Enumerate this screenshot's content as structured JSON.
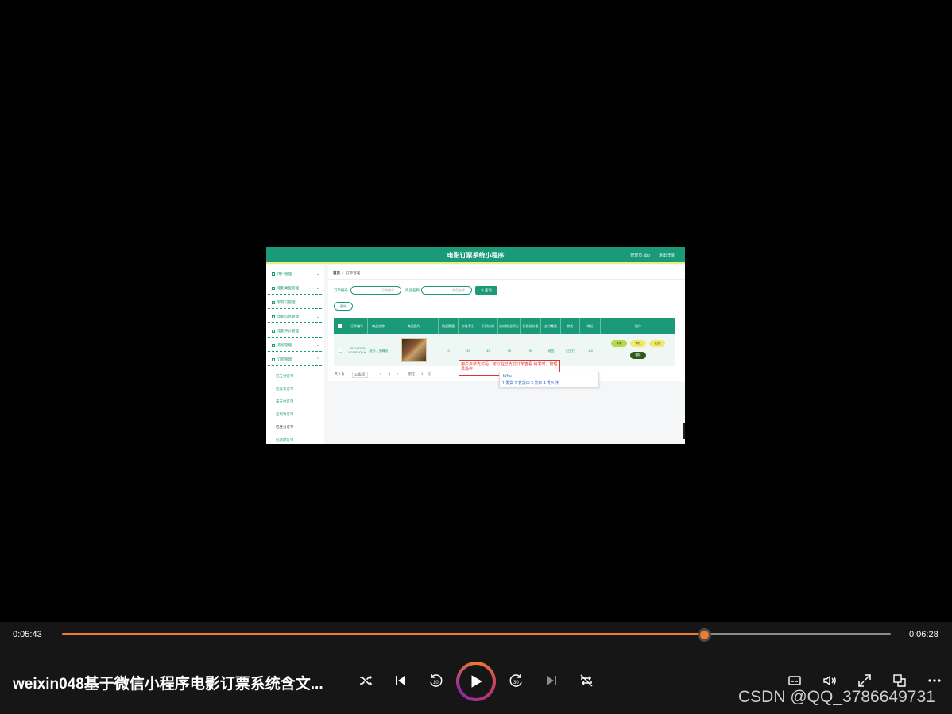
{
  "frame": {
    "app_title": "电影订票系统小程序",
    "user_info": "管理员 abo",
    "logout": "退出登录",
    "sidebar": {
      "items": [
        "用户管理",
        "电影类型管理",
        "影院订管理",
        "电影信息管理",
        "电影评价管理",
        "系统管理",
        "订单管理"
      ],
      "sub_items": [
        "已支付订单",
        "已发货订单",
        "未支付订单",
        "已取消订单",
        "已支付订单",
        "已退款订单"
      ]
    },
    "breadcrumb": {
      "home": "首页",
      "current": "订单管理"
    },
    "filters": {
      "order_no_label": "订单编号",
      "order_no_placeholder": "订单编号",
      "product_label": "商品名称",
      "product_placeholder": "商品名称",
      "search_button": "查询",
      "delete_button": "删除"
    },
    "table": {
      "headers": [
        "订单编号",
        "商品名称",
        "商品图片",
        "购买数量",
        "价格/积分",
        "折扣价格",
        "总价格/总积分",
        "折扣总价格",
        "支付类型",
        "状态",
        "地址",
        "操作"
      ],
      "row": {
        "order_no": "2021/02/09 1:07/02/09 fs",
        "product_name": "剧好、多峰员",
        "quantity": "2",
        "price": "45",
        "discount_price": "45",
        "total": "90",
        "discount_total": "90",
        "pay_type": "现金",
        "status": "已支付",
        "address": "1,4"
      },
      "ops": [
        "详情",
        "修改",
        "发货",
        "删除"
      ]
    },
    "pager": {
      "total": "共 1 条",
      "per_page": "10条/页",
      "page": "1",
      "goto": "前往",
      "goto_suffix": "页",
      "goto_page": "1"
    },
    "tooltip": "用户点单支付后，可以在已支付订单查看 待发时，管理员操作",
    "ime": {
      "pinyin": "fa'hu",
      "candidates": [
        "1.发货",
        "2.发货中",
        "3.发布",
        "4.发",
        "5.法"
      ]
    }
  },
  "player": {
    "elapsed": "0:05:43",
    "duration": "0:06:28",
    "progress": 0.775,
    "title": "weixin048基于微信小程序电影订票系统含文...",
    "accent": "#f07a30",
    "controls": [
      "shuffle-icon",
      "previous-icon",
      "rewind-10-icon",
      "play-icon",
      "forward-30-icon",
      "next-icon",
      "repeat-off-icon",
      "subtitles-icon",
      "volume-icon",
      "fullscreen-icon",
      "miniplayer-icon",
      "more-icon"
    ],
    "rewind_label": "10",
    "forward_label": "30"
  },
  "watermark": "CSDN @QQ_3786649731"
}
